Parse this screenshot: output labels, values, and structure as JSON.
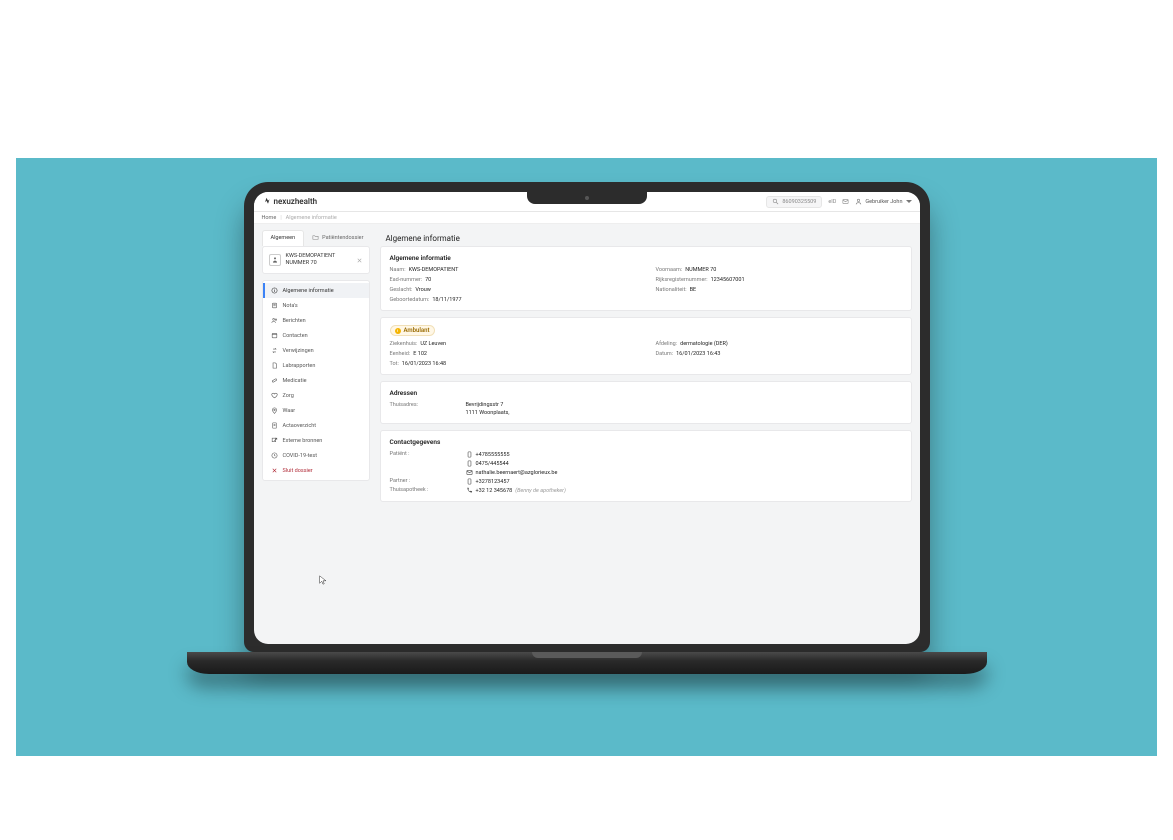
{
  "header": {
    "brand": "nexuzhealth",
    "search_value": "86090325509",
    "eid_label": "eID",
    "user_label": "Gebruiker John"
  },
  "breadcrumb": {
    "home": "Home",
    "current": "Algemene informatie"
  },
  "tabs": {
    "general": "Algemeen",
    "dossier": "Patiëntendossier"
  },
  "page_title": "Algemene informatie",
  "patient": {
    "name_line1": "KWS-DEMOPATIENT",
    "name_line2": "NUMMER 70"
  },
  "side_nav": [
    {
      "id": "info",
      "label": "Algemene informatie",
      "icon": "info",
      "active": true
    },
    {
      "id": "notas",
      "label": "Nota's",
      "icon": "note",
      "active": false
    },
    {
      "id": "berichten",
      "label": "Berichten",
      "icon": "people",
      "active": false
    },
    {
      "id": "contacten",
      "label": "Contacten",
      "icon": "calendar",
      "active": false
    },
    {
      "id": "verwijz",
      "label": "Verwijzingen",
      "icon": "swap",
      "active": false
    },
    {
      "id": "labrap",
      "label": "Labrapporten",
      "icon": "doc",
      "active": false
    },
    {
      "id": "medicatie",
      "label": "Medicatie",
      "icon": "pill",
      "active": false
    },
    {
      "id": "zorg",
      "label": "Zorg",
      "icon": "heart",
      "active": false
    },
    {
      "id": "waar",
      "label": "Waar",
      "icon": "pin",
      "active": false
    },
    {
      "id": "acta",
      "label": "Actaoverzicht",
      "icon": "file",
      "active": false
    },
    {
      "id": "externe",
      "label": "Externe bronnen",
      "icon": "ext",
      "active": false
    },
    {
      "id": "covid",
      "label": "COVID-19-test",
      "icon": "clock",
      "active": false
    },
    {
      "id": "close",
      "label": "Sluit dossier",
      "icon": "close",
      "active": false
    }
  ],
  "cards": {
    "info": {
      "title": "Algemene informatie",
      "naam_k": "Naam:",
      "naam_v": "KWS-DEMOPATIENT",
      "ead_k": "Ead-nummer:",
      "ead_v": "70",
      "geslacht_k": "Geslacht:",
      "geslacht_v": "Vrouw",
      "gd_k": "Geboortedatum:",
      "gd_v": "18/11/1977",
      "voornaam_k": "Voornaam:",
      "voornaam_v": "NUMMER 70",
      "rr_k": "Rijksregisternummer:",
      "rr_v": "12345607001",
      "nat_k": "Nationaliteit:",
      "nat_v": "BE"
    },
    "ambulant": {
      "status": "Ambulant",
      "zh_k": "Ziekenhuis:",
      "zh_v": "UZ Leuven",
      "eenh_k": "Eenheid:",
      "eenh_v": "E 102",
      "tot_k": "Tot:",
      "tot_v": "16/01/2023 16:48",
      "afd_k": "Afdeling:",
      "afd_v": "dermatologie (DER)",
      "dat_k": "Datum:",
      "dat_v": "16/01/2023 16:43"
    },
    "adressen": {
      "title": "Adressen",
      "thuis_k": "Thuisadres:",
      "line1": "Bevrijdingsstr 7",
      "line2": "1111 Woonplaats,"
    },
    "contact": {
      "title": "Contactgegevens",
      "patient_k": "Patiënt :",
      "phone1": "+4785555555",
      "phone2": "0475/445544",
      "email": "nathalie.beernaert@azglorieux.be",
      "partner_k": "Partner :",
      "partner_phone": "+3278123457",
      "apoth_k": "Thuisapotheek :",
      "apoth_phone": "+32 12 345678",
      "apoth_note": "(Benny de apotheker)"
    }
  }
}
